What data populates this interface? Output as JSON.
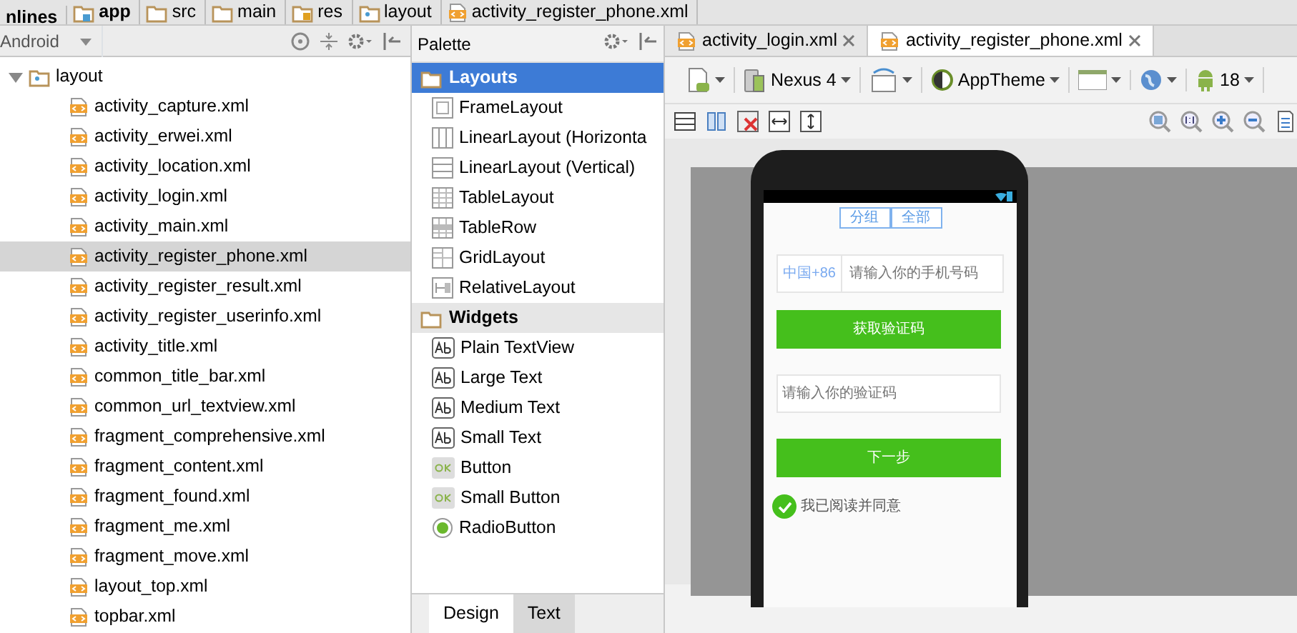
{
  "breadcrumbs": [
    {
      "label": "nlines",
      "kind": "project"
    },
    {
      "label": "app",
      "kind": "module"
    },
    {
      "label": "src",
      "kind": "folder"
    },
    {
      "label": "main",
      "kind": "folder"
    },
    {
      "label": "res",
      "kind": "res"
    },
    {
      "label": "layout",
      "kind": "layout"
    },
    {
      "label": "activity_register_phone.xml",
      "kind": "xml"
    }
  ],
  "project_view": {
    "label": "Android"
  },
  "tree": {
    "label": "layout",
    "expanded": true,
    "children": [
      {
        "label": "activity_capture.xml",
        "selected": false
      },
      {
        "label": "activity_erwei.xml",
        "selected": false
      },
      {
        "label": "activity_location.xml",
        "selected": false
      },
      {
        "label": "activity_login.xml",
        "selected": false
      },
      {
        "label": "activity_main.xml",
        "selected": false
      },
      {
        "label": "activity_register_phone.xml",
        "selected": true
      },
      {
        "label": "activity_register_result.xml",
        "selected": false
      },
      {
        "label": "activity_register_userinfo.xml",
        "selected": false
      },
      {
        "label": "activity_title.xml",
        "selected": false
      },
      {
        "label": "common_title_bar.xml",
        "selected": false
      },
      {
        "label": "common_url_textview.xml",
        "selected": false
      },
      {
        "label": "fragment_comprehensive.xml",
        "selected": false
      },
      {
        "label": "fragment_content.xml",
        "selected": false
      },
      {
        "label": "fragment_found.xml",
        "selected": false
      },
      {
        "label": "fragment_me.xml",
        "selected": false
      },
      {
        "label": "fragment_move.xml",
        "selected": false
      },
      {
        "label": "layout_top.xml",
        "selected": false
      },
      {
        "label": "topbar.xml",
        "selected": false
      }
    ]
  },
  "editor_tabs": [
    {
      "label": "activity_login.xml",
      "selected": false
    },
    {
      "label": "activity_register_phone.xml",
      "selected": true
    }
  ],
  "palette": {
    "title": "Palette",
    "groups": [
      {
        "label": "Layouts",
        "selected": true,
        "items": [
          {
            "label": "FrameLayout",
            "kind": "frame"
          },
          {
            "label": "LinearLayout (Horizonta",
            "kind": "linear-h"
          },
          {
            "label": "LinearLayout (Vertical)",
            "kind": "linear-v"
          },
          {
            "label": "TableLayout",
            "kind": "table"
          },
          {
            "label": "TableRow",
            "kind": "tablerow"
          },
          {
            "label": "GridLayout",
            "kind": "grid"
          },
          {
            "label": "RelativeLayout",
            "kind": "relative"
          }
        ]
      },
      {
        "label": "Widgets",
        "selected": false,
        "items": [
          {
            "label": "Plain TextView",
            "kind": "text"
          },
          {
            "label": "Large Text",
            "kind": "text"
          },
          {
            "label": "Medium Text",
            "kind": "text"
          },
          {
            "label": "Small Text",
            "kind": "text"
          },
          {
            "label": "Button",
            "kind": "button"
          },
          {
            "label": "Small Button",
            "kind": "button"
          },
          {
            "label": "RadioButton",
            "kind": "radio"
          }
        ]
      }
    ]
  },
  "bottom_tabs": [
    {
      "label": "Design",
      "selected": true
    },
    {
      "label": "Text",
      "selected": false
    }
  ],
  "toolbar": {
    "device": "Nexus 4",
    "theme": "AppTheme",
    "api": "18"
  },
  "preview": {
    "segments": [
      "分组",
      "全部"
    ],
    "country_code": "中国+86",
    "phone_placeholder": "请输入你的手机号码",
    "get_code_button": "获取验证码",
    "code_placeholder": "请输入你的验证码",
    "next_button": "下一步",
    "agree_checked": true,
    "agree_text": "我已阅读并同意"
  }
}
